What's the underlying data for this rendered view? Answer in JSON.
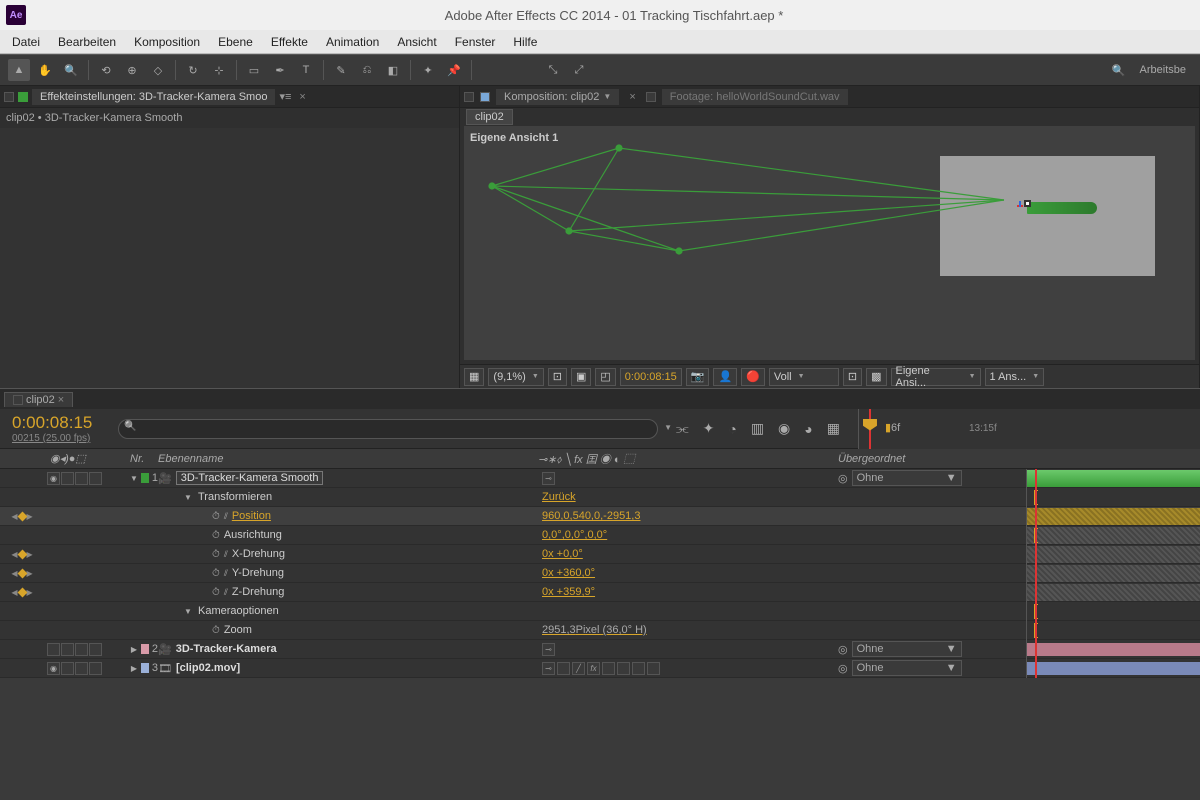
{
  "window": {
    "title": "Adobe After Effects CC 2014 - 01 Tracking Tischfahrt.aep *",
    "badge": "Ae"
  },
  "menu": {
    "items": [
      "Datei",
      "Bearbeiten",
      "Komposition",
      "Ebene",
      "Effekte",
      "Animation",
      "Ansicht",
      "Fenster",
      "Hilfe"
    ]
  },
  "toolbar": {
    "workspace": "Arbeitsbe"
  },
  "effect_panel": {
    "tab": "Effekteinstellungen: 3D-Tracker-Kamera Smoo",
    "breadcrumb": "clip02 • 3D-Tracker-Kamera Smooth"
  },
  "comp_panel": {
    "tab_active": "Komposition: clip02",
    "tab_inactive": "Footage: helloWorldSoundCut.wav",
    "flow": "clip02",
    "view_label": "Eigene Ansicht 1",
    "status": {
      "zoom": "(9,1%)",
      "timecode": "0:00:08:15",
      "quality": "Voll",
      "view": "Eigene Ansi...",
      "views_count": "1 Ans..."
    }
  },
  "timeline": {
    "tab": "clip02",
    "timecode": "0:00:08:15",
    "framerate": "00215 (25.00 fps)",
    "ruler_marker": "6f",
    "ruler_tick": "13:15f",
    "columns": {
      "toggles_hdr": "◉◂)●⬚",
      "nr": "Nr.",
      "name": "Ebenenname",
      "switches_hdr": "⊸∗⬨ ╲ fx 囯 ◉ ◐ ⬚",
      "parent": "Übergeordnet"
    },
    "layers": [
      {
        "nr": "1",
        "name": "3D-Tracker-Kamera Smooth",
        "color": "#3a9d3a",
        "boxed": true,
        "parent": "Ohne",
        "track": "green"
      },
      {
        "nr": "2",
        "name": "3D-Tracker-Kamera",
        "color": "#d89aa8",
        "parent": "Ohne",
        "track": "pink"
      },
      {
        "nr": "3",
        "name": "[clip02.mov]",
        "color": "#9ab0d8",
        "parent": "Ohne",
        "track": "blue",
        "fx": true
      }
    ],
    "groups": [
      {
        "label": "Transformieren",
        "reset": "Zurück"
      },
      {
        "label": "Kameraoptionen"
      }
    ],
    "props": [
      {
        "label": "Position",
        "value": "960,0,540,0,-2951,3",
        "kf": true,
        "sel": true,
        "track": "yellow"
      },
      {
        "label": "Ausrichtung",
        "value": "0,0°,0,0°,0,0°",
        "track": "hatch"
      },
      {
        "label": "X-Drehung",
        "value": "0x +0,0°",
        "kf": true,
        "track": "hatch"
      },
      {
        "label": "Y-Drehung",
        "value": "0x +360,0°",
        "kf": true,
        "track": "hatch"
      },
      {
        "label": "Z-Drehung",
        "value": "0x +359,9°",
        "kf": true,
        "track": "hatch"
      }
    ],
    "zoom": {
      "label": "Zoom",
      "value": "2951,3",
      "unit": "Pixel (36,0° H)"
    }
  }
}
